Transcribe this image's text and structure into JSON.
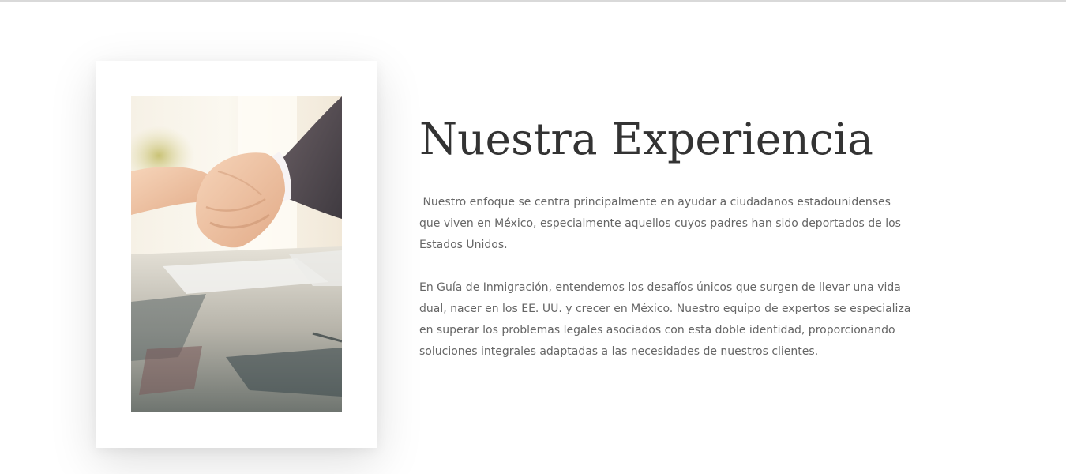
{
  "section": {
    "title": "Nuestra Experiencia",
    "paragraphs": [
      " Nuestro enfoque se centra principalmente en ayudar a ciudadanos estadounidenses que viven en México, especialmente aquellos cuyos padres han sido deportados de los Estados Unidos.",
      "En Guía de Inmigración, entendemos los desafíos únicos que surgen de llevar una vida dual, nacer en los EE. UU. y crecer en México. Nuestro equipo de expertos se especializa en superar los problemas legales asociados con esta doble identidad, proporcionando soluciones integrales adaptadas a las necesidades de nuestros clientes."
    ]
  },
  "image": {
    "subject": "handshake-photo"
  },
  "colors": {
    "title": "#333333",
    "body_text": "#666666",
    "card_background": "#ffffff",
    "page_background": "#ffffff"
  }
}
